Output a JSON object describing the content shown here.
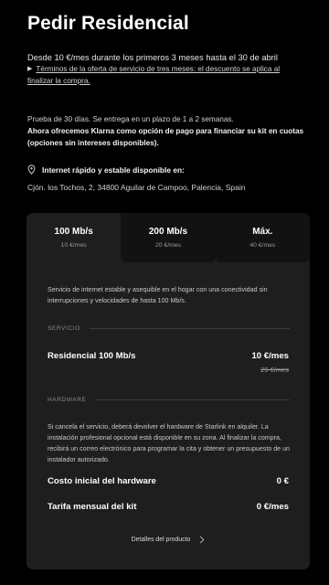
{
  "header": {
    "title": "Pedir Residencial",
    "promo": "Desde 10 €/mes durante los primeros 3 meses hasta el 30 de abril",
    "terms_link": "Términos de la oferta de servicio de tres meses: el descuento se aplica al finalizar la compra."
  },
  "info": {
    "trial": "Prueba de 30 días. Se entrega en un plazo de 1 a 2 semanas.",
    "klarna": "Ahora ofrecemos Klarna como opción de pago para financiar su kit en cuotas (opciones sin intereses disponibles)."
  },
  "availability": {
    "icon": "location-pin-icon",
    "label": "Internet rápido y estable disponible en:",
    "address": "Cjón. los Tochos, 2, 34800 Aguilar de Campoo, Palencia, Spain"
  },
  "plans": {
    "tabs": [
      {
        "label": "100 Mb/s",
        "price": "10 €/mes",
        "selected": true
      },
      {
        "label": "200 Mb/s",
        "price": "20 €/mes",
        "selected": false
      },
      {
        "label": "Máx.",
        "price": "40 €/mes",
        "selected": false
      }
    ],
    "description": "Servicio de internet estable y asequible en el hogar con una conectividad sin interrupciones y velocidades de hasta 100 Mb/s.",
    "service_label": "SERVICIO",
    "service_name": "Residencial 100 Mb/s",
    "service_price": "10 €/mes",
    "service_old_price": "29 €/mes",
    "hardware_label": "HARDWARE",
    "hardware_note": "Si cancela el servicio, deberá devolver el hardware de Starlink en alquiler. La instalación profesional opcional está disponible en su zona. Al finalizar la compra, recibirá un correo electrónico para programar la cita y obtener un presupuesto de un instalador autorizado.",
    "hw_cost_label": "Costo inicial del hardware",
    "hw_cost_value": "0 €",
    "kit_fee_label": "Tarifa mensual del kit",
    "kit_fee_value": "0 €/mes",
    "details_link": "Detalles del producto"
  },
  "colors": {
    "background": "#000000",
    "card": "#1e1e1e",
    "tab_inactive": "#121212"
  }
}
